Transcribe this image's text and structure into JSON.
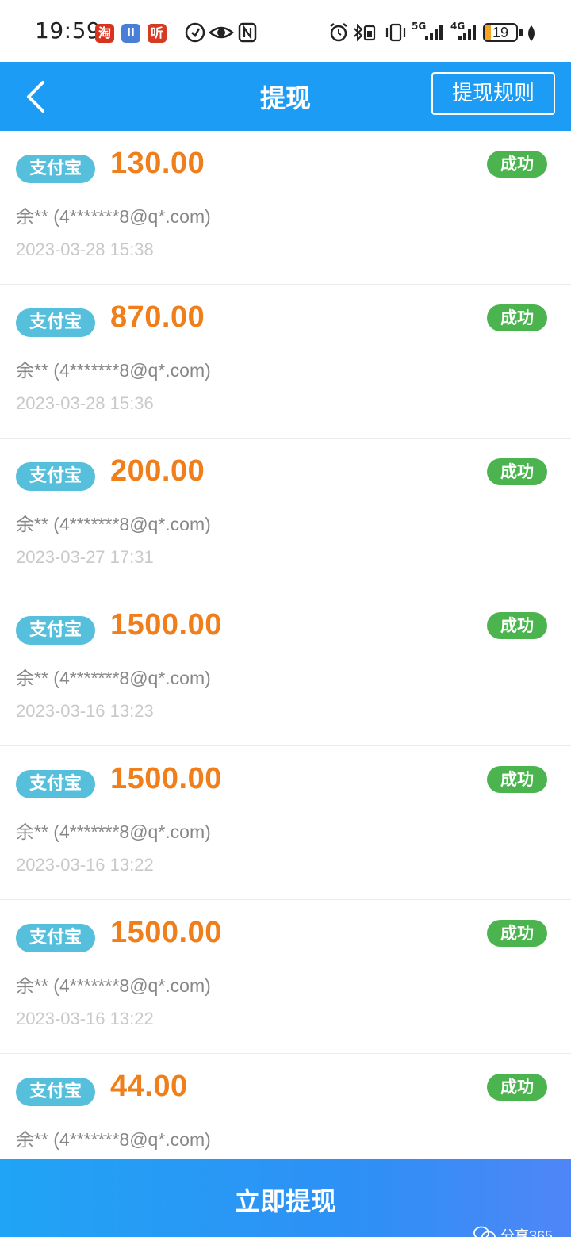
{
  "status_bar": {
    "time": "19:59",
    "app_icons": [
      "taobao-icon",
      "pause-icon",
      "ting-icon"
    ],
    "taobao_char": "淘",
    "pause_char": "II",
    "ting_char": "听",
    "network_1": "5G",
    "network_2": "4G",
    "battery_level": "19",
    "battery_fraction": 0.19
  },
  "nav": {
    "title": "提现",
    "rules_label": "提现规则"
  },
  "records": [
    {
      "method": "支付宝",
      "amount": "130.00",
      "status": "成功",
      "account": "余** (4*******8@q*.com)",
      "time": "2023-03-28 15:38"
    },
    {
      "method": "支付宝",
      "amount": "870.00",
      "status": "成功",
      "account": "余** (4*******8@q*.com)",
      "time": "2023-03-28 15:36"
    },
    {
      "method": "支付宝",
      "amount": "200.00",
      "status": "成功",
      "account": "余** (4*******8@q*.com)",
      "time": "2023-03-27 17:31"
    },
    {
      "method": "支付宝",
      "amount": "1500.00",
      "status": "成功",
      "account": "余** (4*******8@q*.com)",
      "time": "2023-03-16 13:23"
    },
    {
      "method": "支付宝",
      "amount": "1500.00",
      "status": "成功",
      "account": "余** (4*******8@q*.com)",
      "time": "2023-03-16 13:22"
    },
    {
      "method": "支付宝",
      "amount": "1500.00",
      "status": "成功",
      "account": "余** (4*******8@q*.com)",
      "time": "2023-03-16 13:22"
    },
    {
      "method": "支付宝",
      "amount": "44.00",
      "status": "成功",
      "account": "余** (4*******8@q*.com)",
      "time": ""
    }
  ],
  "bottom": {
    "withdraw_label": "立即提现",
    "watermark": "分享365"
  },
  "colors": {
    "nav": "#1d9cf6",
    "amount": "#ef7e1b",
    "method_badge": "#56bfdc",
    "status_success": "#4bb44f"
  }
}
